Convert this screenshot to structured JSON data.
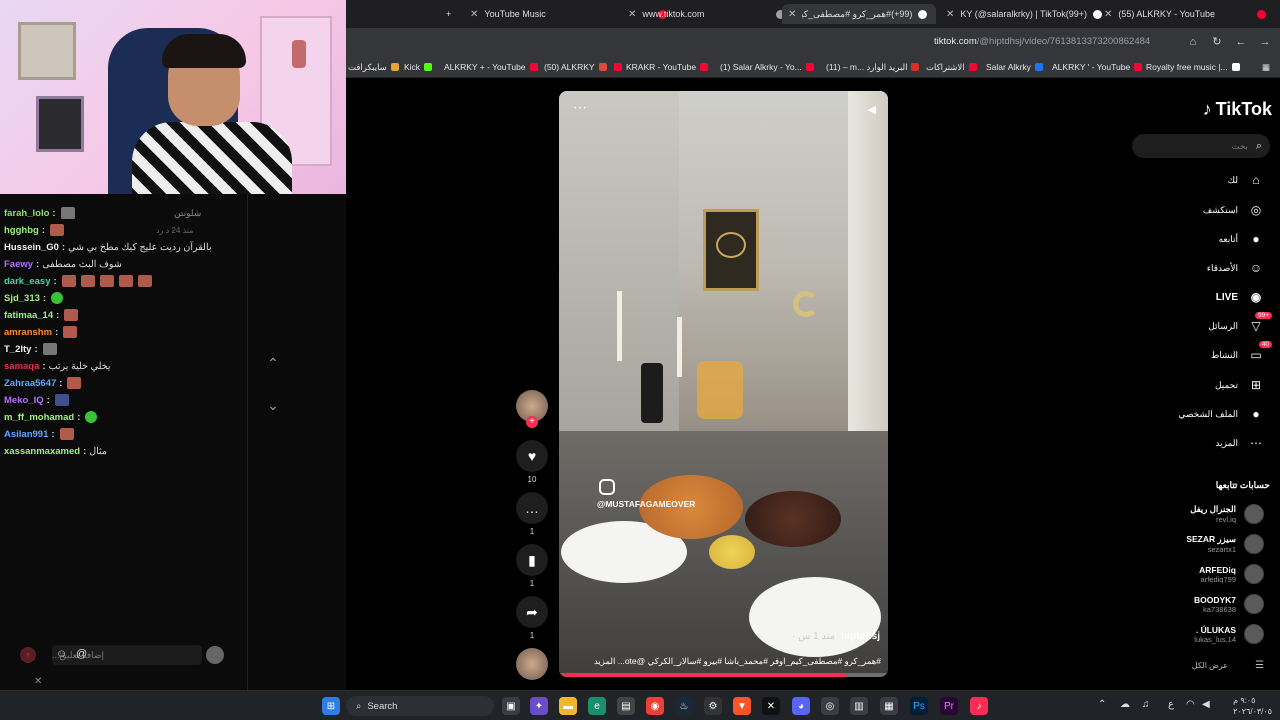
{
  "browser": {
    "tabs": [
      {
        "label": "YouTube Music",
        "color": "#ff0033"
      },
      {
        "label": "www.tiktok.com",
        "color": "#9aa0a6"
      },
      {
        "label": "(99+)#همر_كرو #مصطفى_كيم",
        "color": "#ffffff"
      },
      {
        "label": "KY (@salaralkrky) | TikTok(99+)",
        "color": "#ffffff"
      },
      {
        "label": "(55) ALKRKY - YouTube",
        "color": "#ff0033"
      }
    ],
    "new_tab_label": "+",
    "url_host": "tiktok.com",
    "url_path": "/@hiptdhsj/video/7613813373200862484",
    "bookmarks": [
      {
        "label": "سايبكرافت",
        "color": "#e5a33a"
      },
      {
        "label": "Kick",
        "color": "#53fc18"
      },
      {
        "label": "ALKRKY + - YouTube",
        "color": "#ff0033"
      },
      {
        "label": "(50) ALKRKY",
        "color": "#e04c3c"
      },
      {
        "label": "KRAKR - YouTube",
        "color": "#ff0033"
      },
      {
        "label": "(1) Salar Alkrky - Yo...",
        "color": "#ff0033"
      },
      {
        "label": "(11) – m... البريد الوارد",
        "color": "#d93025"
      },
      {
        "label": "الاشتراكات",
        "color": "#ff0033"
      },
      {
        "label": "Salar Alkrky",
        "color": "#1877f2"
      },
      {
        "label": "ALKRKY ' - YouTube",
        "color": "#ff0033"
      },
      {
        "label": "Royalty free music |...",
        "color": "#ffffff"
      }
    ]
  },
  "chat": {
    "messages": [
      {
        "user": "farah_lolo",
        "color": "#8ee06b",
        "text": "",
        "emote": "gray"
      },
      {
        "user": "hgghbg",
        "color": "#9ef07c",
        "text": "",
        "emote": "red"
      },
      {
        "user": "Hussein_G0",
        "color": "#f0f0f0",
        "text": "بالقرآن رديت عليج كيك مطخ بي شي",
        "emote": ""
      },
      {
        "user": "Faewy",
        "color": "#b26bff",
        "text": "شوف البث مصطفى",
        "emote": ""
      },
      {
        "user": "dark_easy",
        "color": "#48d6a8",
        "text": "",
        "emote": "red5"
      },
      {
        "user": "Sjd_313",
        "color": "#9ef07c",
        "text": "",
        "emote": "green"
      },
      {
        "user": "fatimaa_14",
        "color": "#9ef07c",
        "text": "",
        "emote": "red"
      },
      {
        "user": "amranshm",
        "color": "#ff8a2b",
        "text": "",
        "emote": "red"
      },
      {
        "user": "T_2lty",
        "color": "#f0f0f0",
        "text": "",
        "emote": "gray"
      },
      {
        "user": "samaqa",
        "color": "#e0304a",
        "text": "يخلي خلية يرتب",
        "emote": ""
      },
      {
        "user": "Zahraa5647",
        "color": "#5fa8ff",
        "text": "",
        "emote": "red"
      },
      {
        "user": "Meko_IQ",
        "color": "#b26bff",
        "text": "",
        "emote": "blue"
      },
      {
        "user": "m_ff_mohamad",
        "color": "#9ef07c",
        "text": "",
        "emote": "green"
      },
      {
        "user": "Asilan991",
        "color": "#5fa8ff",
        "text": "",
        "emote": "red"
      },
      {
        "user": "xassanmaxamed",
        "color": "#9ef07c",
        "text": "مثال",
        "emote": ""
      }
    ],
    "ghost_text_1": "شلونتن",
    "ghost_text_2": "منذ 24 د    رد",
    "input_placeholder": "إضافة تعليق..."
  },
  "tiktok": {
    "logo": "TikTok",
    "search_placeholder": "بحث",
    "nav": [
      {
        "label": "لك",
        "icon": "home-icon",
        "glyph": "⌂",
        "badge": ""
      },
      {
        "label": "استكشف",
        "icon": "compass-icon",
        "glyph": "◎",
        "badge": ""
      },
      {
        "label": "أتابعه",
        "icon": "following-avatar-icon",
        "glyph": "●",
        "badge": ""
      },
      {
        "label": "الأصدقاء",
        "icon": "friends-icon",
        "glyph": "☺",
        "badge": ""
      },
      {
        "label": "LIVE",
        "icon": "live-icon",
        "glyph": "◉",
        "badge": ""
      },
      {
        "label": "الرسائل",
        "icon": "messages-icon",
        "glyph": "▽",
        "badge": "99+"
      },
      {
        "label": "النشاط",
        "icon": "activity-icon",
        "glyph": "▭",
        "badge": "40"
      },
      {
        "label": "تحميل",
        "icon": "upload-icon",
        "glyph": "⊞",
        "badge": ""
      },
      {
        "label": "الملف الشخصي",
        "icon": "profile-icon",
        "glyph": "●",
        "badge": ""
      },
      {
        "label": "المزيد",
        "icon": "more-icon",
        "glyph": "⋯",
        "badge": ""
      }
    ],
    "following_title": "حسابات تتابعها",
    "following": [
      {
        "name": "الجنرال ريفل",
        "handle": "revl.iq"
      },
      {
        "name": "SEZAR سيزر",
        "handle": "sezartx1"
      },
      {
        "name": "ARFEDiq",
        "handle": "arfediq799"
      },
      {
        "name": "BOODYK7",
        "handle": "ka738638"
      },
      {
        "name": ". ÚLUKAS",
        "handle": "lukas_lus.14"
      }
    ],
    "see_all": "عرض الكل",
    "video": {
      "watermark": "@MUSTAFAGAMEOVER",
      "author": "hiptdhsj",
      "author_meta": "منذ 1 س ·",
      "caption": "#همر_كرو #مصطفى_كيم_اوفر #محمد_باشا #بيرو #سالار_الكركي @ote... المزيد",
      "progress": 0.87
    },
    "actions": {
      "likes": "10",
      "comments": "1",
      "saves": "1",
      "shares": "1"
    }
  },
  "taskbar": {
    "search_label": "Search",
    "clock_time": "٩:٠٥ م",
    "clock_date": "٢٠٢٦/٠٣/٠٥",
    "lang": "ع"
  }
}
